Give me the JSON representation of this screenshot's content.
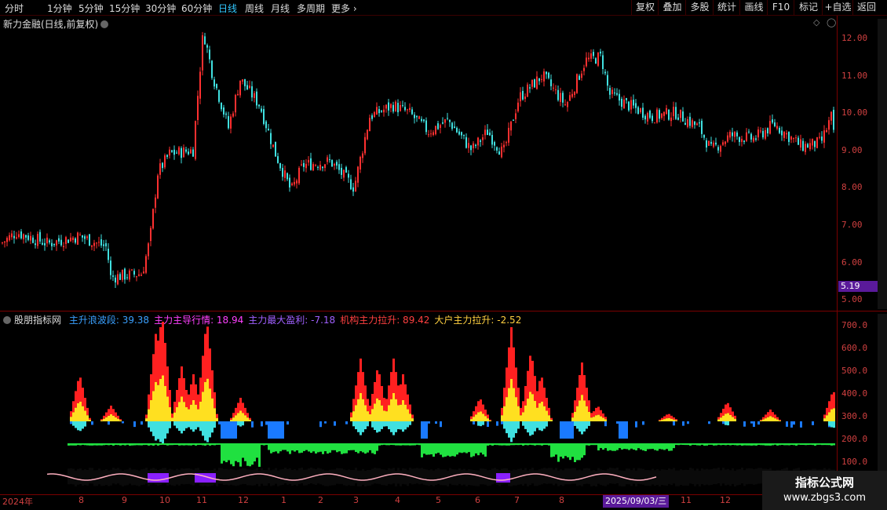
{
  "toolbar": {
    "periods": [
      "分时",
      "1分钟",
      "5分钟",
      "15分钟",
      "30分钟",
      "60分钟",
      "日线",
      "周线",
      "月线",
      "多周期",
      "更多"
    ],
    "active_period": "日线",
    "buttons": [
      "复权",
      "叠加",
      "多股",
      "统计",
      "画线",
      "F10",
      "标记",
      "+自选",
      "返回"
    ]
  },
  "main_chart": {
    "title": "新力金融(日线,前复权)",
    "price_ticks": [
      "12.00",
      "11.00",
      "10.00",
      "9.00",
      "8.00",
      "7.00",
      "6.00",
      "5.00"
    ],
    "current_price": "5.19",
    "colors": {
      "up": "#ff3030",
      "down": "#40e0e0"
    }
  },
  "indicator": {
    "name": "股朋指标网",
    "values": [
      {
        "label": "主升浪波段:",
        "value": "39.38",
        "color": "#3aa0ff"
      },
      {
        "label": "主力主导行情:",
        "value": "18.94",
        "color": "#ff40ff"
      },
      {
        "label": "主力最大盈利:",
        "value": "-7.18",
        "color": "#a060ff"
      },
      {
        "label": "机构主力拉升:",
        "value": "89.42",
        "color": "#ff4040"
      },
      {
        "label": "大户主力拉升:",
        "value": "-2.52",
        "color": "#ffd040"
      }
    ],
    "ticks": [
      "700.0",
      "600.0",
      "500.0",
      "400.0",
      "300.0",
      "200.0",
      "100.0"
    ]
  },
  "date_axis": {
    "labels": [
      "2024年",
      "8",
      "9",
      "10",
      "11",
      "12",
      "1",
      "2",
      "3",
      "4",
      "5",
      "6",
      "7",
      "8",
      "11",
      "12"
    ],
    "cursor_date": "2025/09/03/三"
  },
  "watermark": {
    "line1": "指标公式网",
    "line2": "www.zbgs3.com"
  }
}
